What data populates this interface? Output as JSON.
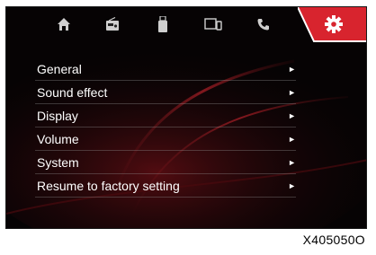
{
  "tabs": [
    {
      "icon": "home-icon"
    },
    {
      "icon": "radio-icon"
    },
    {
      "icon": "usb-icon"
    },
    {
      "icon": "phone-link-icon"
    },
    {
      "icon": "phone-icon"
    },
    {
      "icon": "settings-gear-icon",
      "active": true
    }
  ],
  "menu": {
    "items": [
      {
        "label": "General",
        "arrow": "►"
      },
      {
        "label": "Sound effect",
        "arrow": "►"
      },
      {
        "label": "Display",
        "arrow": "►"
      },
      {
        "label": "Volume",
        "arrow": "►"
      },
      {
        "label": "System",
        "arrow": "►"
      },
      {
        "label": "Resume to factory setting",
        "arrow": "►"
      }
    ]
  },
  "figure_code": "X405050O",
  "colors": {
    "accent": "#d8242e",
    "background": "#060304",
    "text": "#ffffff"
  }
}
